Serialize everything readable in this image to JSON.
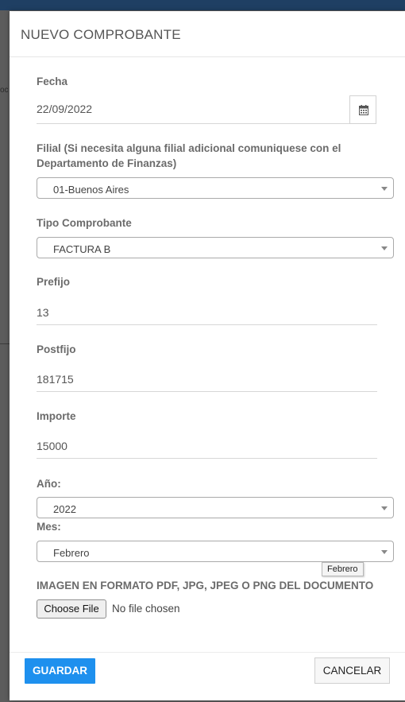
{
  "background": {
    "sliver_text": "oc"
  },
  "modal": {
    "title": "NUEVO COMPROBANTE"
  },
  "form": {
    "fecha": {
      "label": "Fecha",
      "value": "22/09/2022",
      "icon": "calendar-icon"
    },
    "filial": {
      "label": "Filial (Si necesita alguna filial adicional comuniquese con el Departamento de Finanzas)",
      "value": "01-Buenos Aires"
    },
    "tipo_comprobante": {
      "label": "Tipo Comprobante",
      "value": "FACTURA B"
    },
    "prefijo": {
      "label": "Prefijo",
      "value": "13"
    },
    "postfijo": {
      "label": "Postfijo",
      "value": "181715"
    },
    "importe": {
      "label": "Importe",
      "value": "15000"
    },
    "anio": {
      "label": "Año:",
      "value": "2022"
    },
    "mes": {
      "label": "Mes:",
      "value": "Febrero",
      "tooltip": "Febrero"
    },
    "imagen": {
      "label": "IMAGEN EN FORMATO PDF, JPG, JPEG O PNG DEL DOCUMENTO",
      "button_label": "Choose File",
      "status": "No file chosen"
    }
  },
  "footer": {
    "save_label": "GUARDAR",
    "cancel_label": "CANCELAR"
  },
  "colors": {
    "primary": "#1e90ee",
    "header_strip": "#1f3f63",
    "backdrop": "#5c5c5c"
  }
}
